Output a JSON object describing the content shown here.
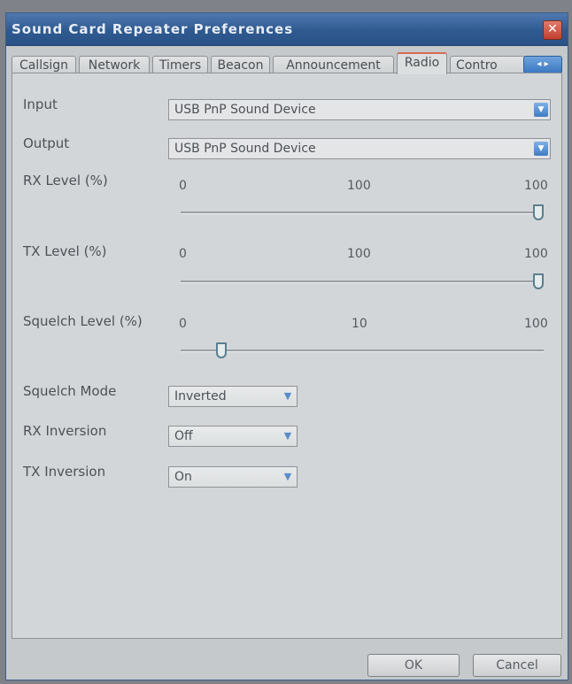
{
  "window": {
    "title": "Sound Card Repeater Preferences",
    "close_glyph": "✕"
  },
  "tabs": [
    {
      "label": "Callsign"
    },
    {
      "label": "Network"
    },
    {
      "label": "Timers"
    },
    {
      "label": "Beacon"
    },
    {
      "label": "Announcement"
    },
    {
      "label": "Radio",
      "active": true
    },
    {
      "label": "Contro"
    }
  ],
  "tab_scroll": {
    "glyph": "◂ ▸"
  },
  "radio": {
    "input": {
      "label": "Input",
      "value": "USB PnP Sound Device"
    },
    "output": {
      "label": "Output",
      "value": "USB PnP Sound Device"
    },
    "rx_level": {
      "label": "RX Level (%)",
      "min": "0",
      "current": "100",
      "max": "100",
      "position": 1.0
    },
    "tx_level": {
      "label": "TX Level (%)",
      "min": "0",
      "current": "100",
      "max": "100",
      "position": 1.0
    },
    "squelch_level": {
      "label": "Squelch Level (%)",
      "min": "0",
      "current": "10",
      "max": "100",
      "position": 0.1
    },
    "squelch_mode": {
      "label": "Squelch Mode",
      "value": "Inverted"
    },
    "rx_inversion": {
      "label": "RX Inversion",
      "value": "Off"
    },
    "tx_inversion": {
      "label": "TX Inversion",
      "value": "On"
    }
  },
  "buttons": {
    "ok": "OK",
    "cancel": "Cancel"
  },
  "icons": {
    "dropdown": "chevron-down-icon",
    "close": "close-icon",
    "tab_scroll": "arrow-left-right-icon"
  }
}
